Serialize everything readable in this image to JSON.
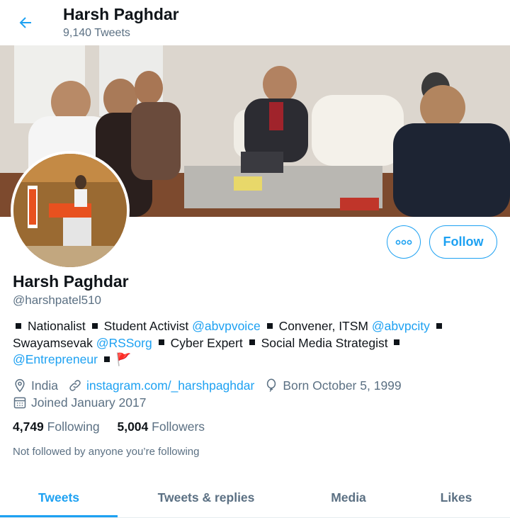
{
  "header": {
    "name": "Harsh Paghdar",
    "tweet_count": "9,140 Tweets"
  },
  "profile": {
    "display_name": "Harsh Paghdar",
    "handle": "@harshpatel510",
    "follow_label": "Follow",
    "bio": {
      "l1_t1": "Nationalist",
      "l1_t2": "Student Activist ",
      "l1_m1": "@abvpvoice",
      "l1_t3": "Convener, ITSM ",
      "l1_m2": "@abvpcity",
      "l2_t1": "Swayamsevak ",
      "l2_m1": "@RSSorg",
      "l2_t2": "Cyber Expert",
      "l2_t3": "Social Media Strategist",
      "l3_m1": "@Entrepreneur",
      "l3_emoji": "🚩"
    },
    "location": "India",
    "website": "instagram.com/_harshpaghdar",
    "birthday": "Born October 5, 1999",
    "joined": "Joined January 2017",
    "following_count": "4,749",
    "following_label": "Following",
    "followers_count": "5,004",
    "followers_label": "Followers",
    "not_followed_text": "Not followed by anyone you’re following"
  },
  "tabs": [
    {
      "label": "Tweets",
      "active": true
    },
    {
      "label": "Tweets & replies",
      "active": false
    },
    {
      "label": "Media",
      "active": false
    },
    {
      "label": "Likes",
      "active": false
    }
  ],
  "icons": {
    "back": "arrow-left-icon",
    "more": "more-horizontal-icon",
    "location": "location-pin-icon",
    "link": "link-icon",
    "birthday": "balloon-icon",
    "joined": "calendar-icon"
  },
  "colors": {
    "accent": "#1da1f2",
    "secondary_text": "#5b7083",
    "primary_text": "#0f1419"
  }
}
